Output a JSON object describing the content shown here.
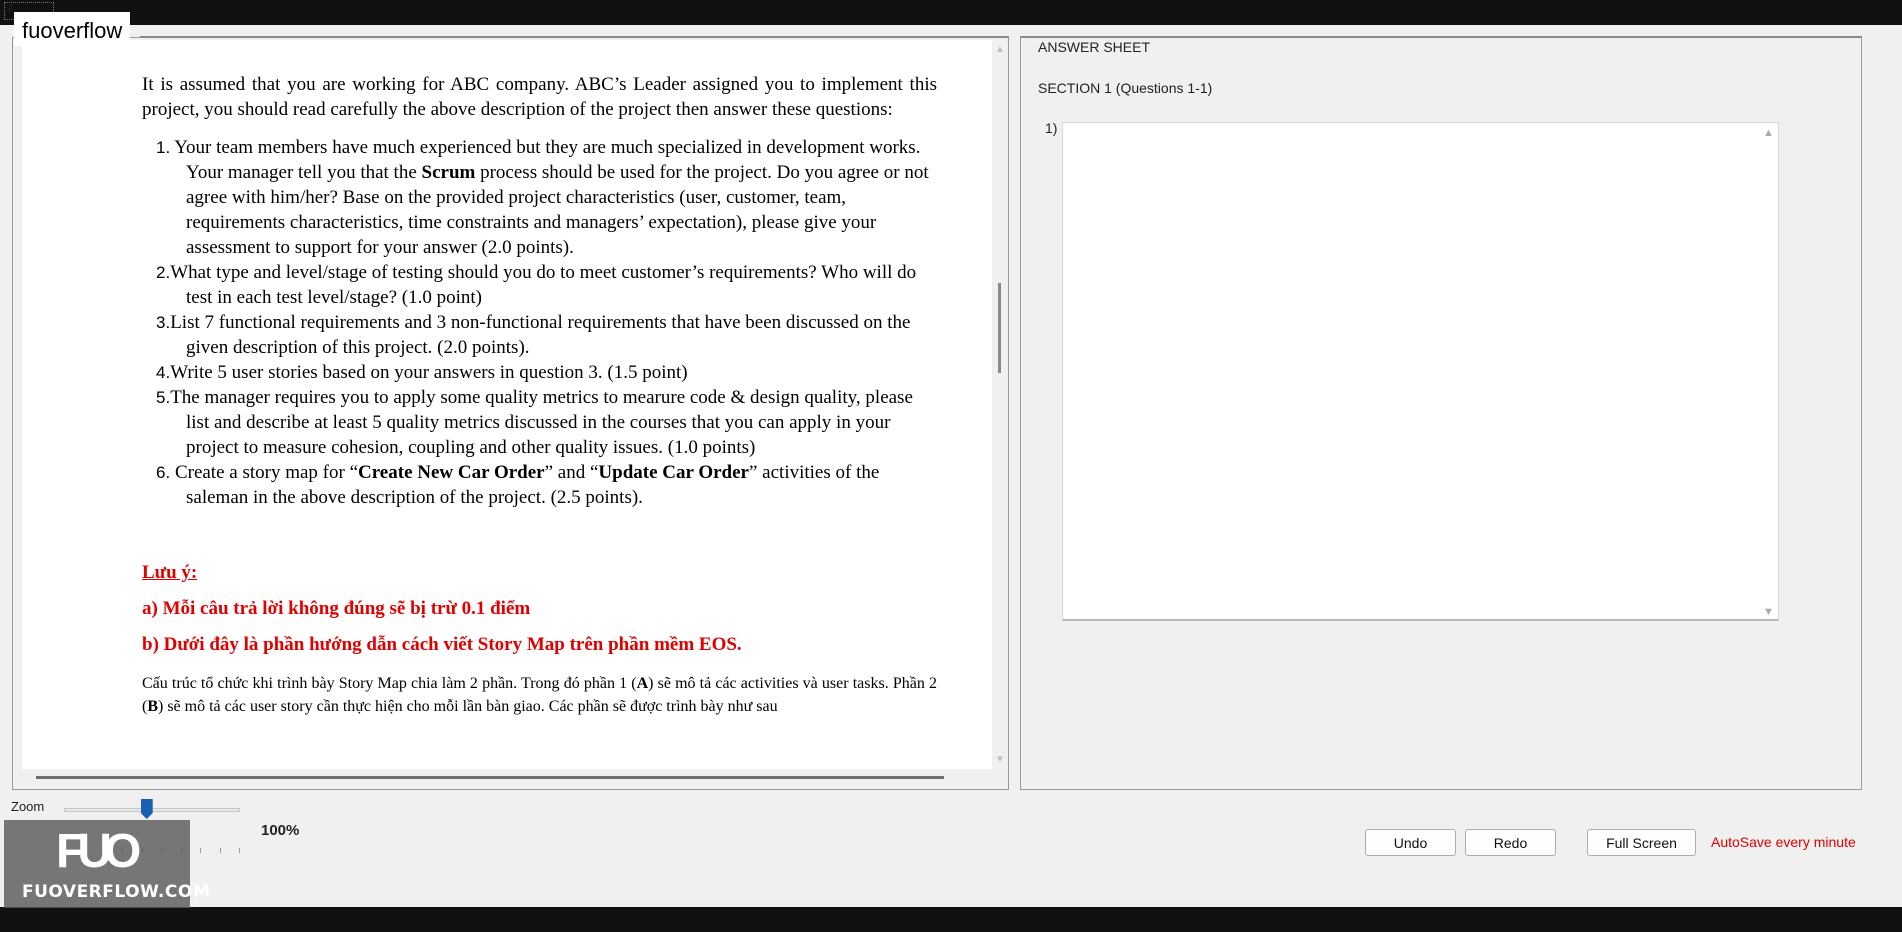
{
  "window": {
    "corner_mark": "F"
  },
  "app": {
    "title": "fuoverflow"
  },
  "document": {
    "intro": "It is assumed that you are working for ABC company. ABC’s Leader assigned you to implement this project, you should read carefully the above description of the project then answer these questions:",
    "questions": [
      {
        "num": "1.",
        "before": " Your team members have much experienced but they are much specialized in development works. Your manager tell you that the ",
        "bold": "Scrum",
        "after": " process should be used for the project. Do you agree or not agree with him/her? Base on the provided project characteristics (user, customer, team,  requirements characteristics, time constraints and managers’ expectation), please give your assessment to support for your answer (2.0 points)."
      },
      {
        "num": "2.",
        "text": "What type and level/stage of testing should you do to meet customer’s requirements? Who will do test in each test level/stage? (1.0 point)"
      },
      {
        "num": "3.",
        "text": "List 7 functional requirements and 3 non-functional requirements that have been discussed on the given description of this project. (2.0 points)."
      },
      {
        "num": "4.",
        "text": "Write 5 user stories based on your answers in question 3. (1.5 point)"
      },
      {
        "num": "5.",
        "text": "The manager requires you to apply some quality metrics to mearure code & design quality, please list and describe at least 5 quality metrics discussed in the courses that you can apply in your project to measure cohesion, coupling and other quality issues. (1.0 points)"
      },
      {
        "num": "6.",
        "before": " Create a story map for “",
        "bold1": "Create New Car Order",
        "mid": "” and “",
        "bold2": "Update Car Order",
        "after": "” activities of the saleman in the above description of the project. (2.5 points)."
      }
    ],
    "note_title": "Lưu ý:",
    "note_colon": ":",
    "note_a": "a) Mỗi câu trả lời không đúng sẽ bị trừ 0.1 điểm",
    "note_b": "b) Dưới đây là phần hướng dẫn cách viết Story Map trên phần mềm EOS.",
    "structure": {
      "p1": "Cấu trúc tổ chức khi trình bày Story Map chia làm 2 phần.  Trong đó phần 1 (",
      "b1": "A",
      "p2": ") sẽ mô tả các activities và user tasks. Phần 2 (",
      "b2": "B",
      "p3": ") sẽ mô tả các user story cần thực hiện cho mỗi lần bàn giao. Các phần sẽ được trình bày như sau"
    }
  },
  "answer_sheet": {
    "title": "ANSWER SHEET",
    "section": "SECTION 1 (Questions 1-1)",
    "question_label": "1)",
    "answer_value": ""
  },
  "zoom": {
    "label": "Zoom",
    "value": "100%",
    "level_fraction": 0.47
  },
  "watermark": {
    "mark": "FUO",
    "text": "FUOVERFLOW.COM"
  },
  "toolbar": {
    "undo": "Undo",
    "redo": "Redo",
    "fullscreen": "Full Screen",
    "autosave": "AutoSave every minute"
  },
  "colors": {
    "note_red": "#e00000",
    "zoom_thumb": "#1a5fb4"
  }
}
